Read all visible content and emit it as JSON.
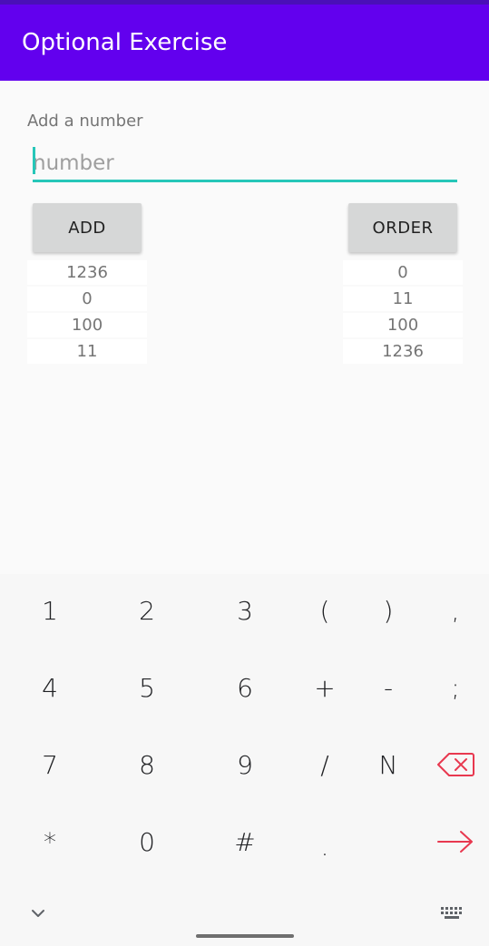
{
  "appbar": {
    "title": "Optional Exercise"
  },
  "form": {
    "label": "Add a number",
    "input": {
      "placeholder": "number",
      "value": ""
    },
    "add_button": "ADD",
    "order_button": "ORDER"
  },
  "lists": {
    "entered": [
      "1236",
      "0",
      "100",
      "11"
    ],
    "ordered": [
      "0",
      "11",
      "100",
      "1236"
    ]
  },
  "keyboard": {
    "rows": [
      [
        "1",
        "2",
        "3",
        "(",
        ")",
        ","
      ],
      [
        "4",
        "5",
        "6",
        "+",
        "-",
        ";"
      ],
      [
        "7",
        "8",
        "9",
        "/",
        "N",
        "backspace-icon"
      ],
      [
        "*",
        "0",
        "#",
        ".",
        "",
        "enter-arrow-icon"
      ]
    ],
    "bottom": [
      "hide-keyboard-chevron-icon",
      "keyboard-switch-icon"
    ]
  },
  "colors": {
    "appbar": "#6200ee",
    "status_strip": "#4a0fb8",
    "accent": "#26c6b8",
    "button_bg": "#d6d7d7",
    "keyboard_action": "#e8384f"
  }
}
